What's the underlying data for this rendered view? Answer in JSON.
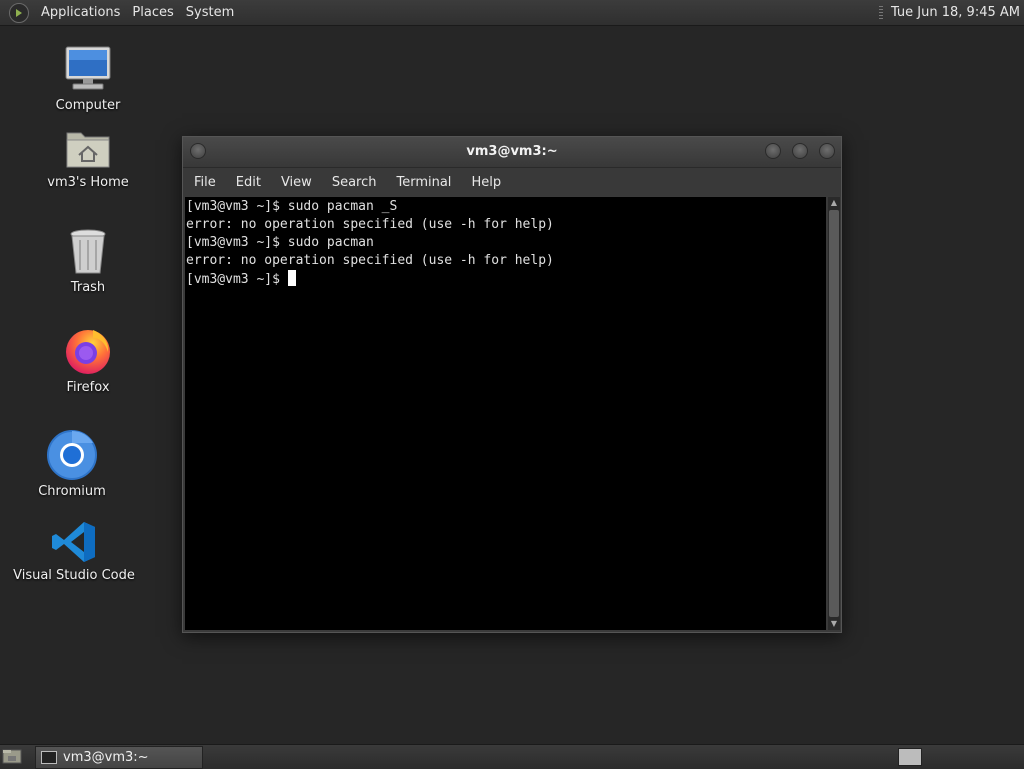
{
  "top_panel": {
    "menus": [
      "Applications",
      "Places",
      "System"
    ],
    "clock": "Tue Jun 18,  9:45 AM"
  },
  "desktop": {
    "icons": [
      {
        "label": "Computer",
        "icon": "computer-icon"
      },
      {
        "label": "vm3's Home",
        "icon": "home-folder-icon"
      },
      {
        "label": "Trash",
        "icon": "trash-icon"
      },
      {
        "label": "Firefox",
        "icon": "firefox-icon"
      },
      {
        "label": "Chromium",
        "icon": "chromium-icon"
      },
      {
        "label": "Visual Studio Code",
        "icon": "vscode-icon"
      }
    ]
  },
  "terminal": {
    "title": "vm3@vm3:~",
    "menu": [
      "File",
      "Edit",
      "View",
      "Search",
      "Terminal",
      "Help"
    ],
    "lines": [
      "[vm3@vm3 ~]$ sudo pacman _S",
      "error: no operation specified (use -h for help)",
      "[vm3@vm3 ~]$ sudo pacman",
      "error: no operation specified (use -h for help)",
      "[vm3@vm3 ~]$ "
    ]
  },
  "taskbar": {
    "task_label": "vm3@vm3:~"
  },
  "colors": {
    "desktop_bg": "#262626",
    "terminal_bg": "#000000",
    "terminal_fg": "#e0e0e0"
  }
}
